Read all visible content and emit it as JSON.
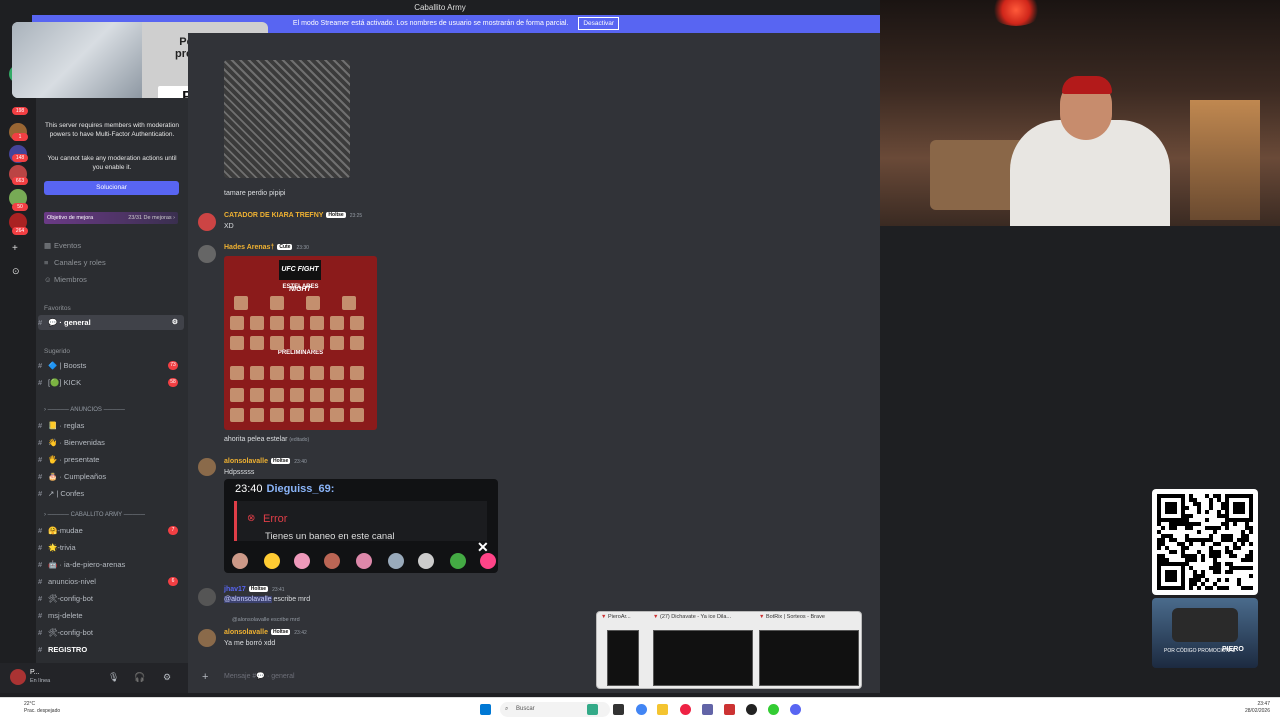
{
  "window": {
    "title": "Caballito Army"
  },
  "streamer": {
    "text": "El modo Streamer está activado. Los nombres de usuario se mostrarán de forma parcial.",
    "button": "Desactivar"
  },
  "promo": {
    "line": "Por código promocional",
    "code": "PIERO"
  },
  "mfa": {
    "line1": "This server requires members with moderation powers to have Multi-Factor Authentication.",
    "line2": "You cannot take any moderation actions until you enable it.",
    "button": "Solucionar"
  },
  "boost": {
    "label": "Objetivo de mejora",
    "value": "23/31 De mejoras ›"
  },
  "sidebar": {
    "links": [
      {
        "icon": "▦",
        "label": "Eventos"
      },
      {
        "icon": "≡",
        "label": "Canales y roles"
      },
      {
        "icon": "☺",
        "label": "Miembros"
      }
    ],
    "favorites_header": "Favoritos",
    "suggested_header": "Sugerido",
    "categories": [
      "ANUNCIOS",
      "CABALLITO ARMY"
    ],
    "channels": [
      {
        "label": "💬 · general",
        "badge": "",
        "active": true
      },
      {
        "label": "🔷 | Boosts",
        "badge": "73",
        "active": false
      },
      {
        "label": "[🟢]   KICK",
        "badge": "58",
        "active": false
      },
      {
        "label": "📒 · reglas",
        "badge": "",
        "active": false
      },
      {
        "label": "👋 · Bienvenidas",
        "badge": "",
        "active": false
      },
      {
        "label": "🖐 · presentate",
        "badge": "",
        "active": false
      },
      {
        "label": "🎂 · Cumpleaños",
        "badge": "",
        "active": false
      },
      {
        "label": "↗ | Confes",
        "badge": "",
        "active": false
      },
      {
        "label": "🤗-mudae",
        "badge": "7",
        "active": false
      },
      {
        "label": "🌟-trivia",
        "badge": "",
        "active": false
      },
      {
        "label": "🤖 · ia-de-piero-arenas",
        "badge": "",
        "active": false
      },
      {
        "label": "anuncios-nivel",
        "badge": "6",
        "active": false
      },
      {
        "label": "🛠-config-bot",
        "badge": "",
        "active": false
      },
      {
        "label": "msj-delete",
        "badge": "",
        "active": false
      },
      {
        "label": "🛠-config-bot",
        "badge": "",
        "active": false
      },
      {
        "label": "REGISTRO",
        "badge": "",
        "active": false
      }
    ]
  },
  "guild_badges": [
    "198",
    "1",
    "148",
    "1",
    "663",
    "50",
    "264"
  ],
  "user": {
    "name": "P...",
    "status": "En línea"
  },
  "messages": {
    "m0_text": "tamare perdio pipipi",
    "m1_name": "CATADOR DE KIARA TREFNY",
    "m1_tag": "Holtse",
    "m1_time": "23:25",
    "m1_text": "XD",
    "m2_name": "Hades Arenas†",
    "m2_tag": "Cute",
    "m2_time": "23:30",
    "ufc": {
      "logo": "UFC FIGHT NIGHT",
      "main": "ESTELARES",
      "prelim": "PRELIMINARES"
    },
    "m2_text": "ahorita pelea estelar",
    "m2_edited": "(editado)",
    "m3_name": "alonsolavalle",
    "m3_tag": "Holtse",
    "m3_time": "23:40",
    "m3_text": "Hdpsssss",
    "m4_name": "jhav17",
    "m4_tag": "Holtse",
    "m4_time": "23:41",
    "m4_mention": "@alonsolavalle",
    "m4_text": "escribe mrd",
    "m5_reply": "@alonsolavalle escribe mrd",
    "m5_name": "alonsolavalle",
    "m5_tag": "Holtse",
    "m5_time": "23:42",
    "m5_text": "Ya me borró xdd"
  },
  "overlay": {
    "time": "23:40",
    "user": "Dieguiss_69:",
    "error_title": "Error",
    "error_body": "Tienes un baneo en este canal",
    "close": "✕"
  },
  "input": {
    "placeholder": "Mensaje #💬 · general"
  },
  "car": {
    "text": "POR CÓDIGO PROMOCIONAL",
    "code": "PIERO"
  },
  "thumbs": [
    "PieroAr...",
    "(27) Dichavate - Ya ice Dila...",
    "BotRix | Sorteos - Brave"
  ],
  "taskbar": {
    "search": "Buscar",
    "weather": "22°C",
    "weather_desc": "Prac. despejado",
    "time": "23:47",
    "date": "28/02/2026"
  }
}
